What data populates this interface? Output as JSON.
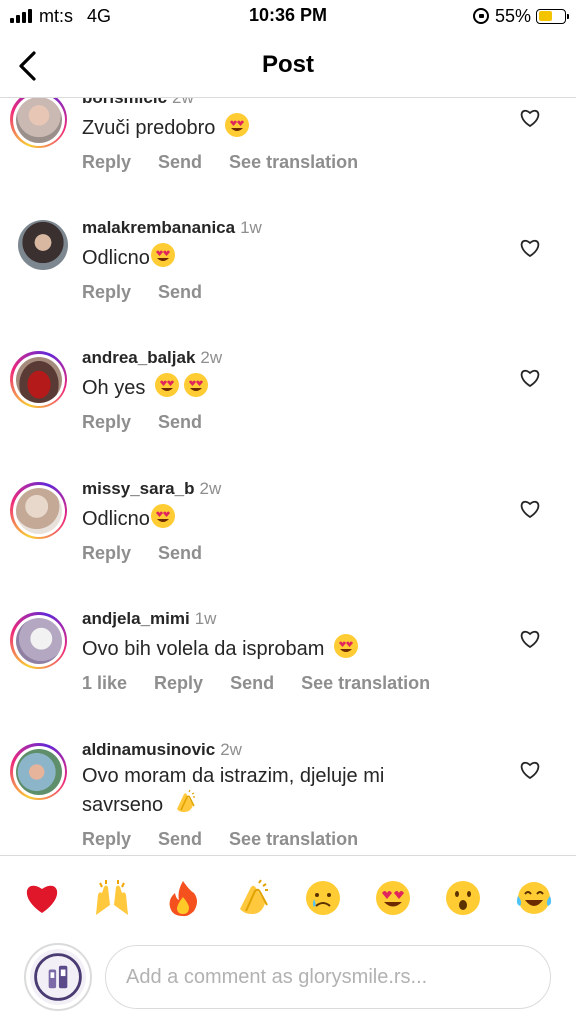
{
  "status_bar": {
    "carrier": "mt:s",
    "network": "4G",
    "time": "10:36 PM",
    "battery": "55%",
    "battery_level": 0.55,
    "battery_color": "#f5c400"
  },
  "header": {
    "back_icon": "chevron-left-icon",
    "title": "Post"
  },
  "comments": [
    {
      "username": "borismicic",
      "time": "2w",
      "text": "Zvuči predobro",
      "emojis": [
        "heart-eyes"
      ],
      "actions": [
        "Reply",
        "Send",
        "See translation"
      ],
      "avatar_ring": true
    },
    {
      "username": "malakrembananica",
      "time": "1w",
      "text": "Odlicno",
      "emojis": [
        "heart-eyes"
      ],
      "actions": [
        "Reply",
        "Send"
      ],
      "avatar_ring": false
    },
    {
      "username": "andrea_baljak",
      "time": "2w",
      "text": "Oh yes",
      "emojis": [
        "heart-eyes",
        "heart-eyes"
      ],
      "actions": [
        "Reply",
        "Send"
      ],
      "avatar_ring": true
    },
    {
      "username": "missy_sara_b",
      "time": "2w",
      "text": "Odlicno",
      "emojis": [
        "heart-eyes"
      ],
      "actions": [
        "Reply",
        "Send"
      ],
      "avatar_ring": true
    },
    {
      "username": "andjela_mimi",
      "time": "1w",
      "text": "Ovo bih volela da isprobam",
      "emojis": [
        "heart-eyes"
      ],
      "actions": [
        "1 like",
        "Reply",
        "Send",
        "See translation"
      ],
      "avatar_ring": true
    },
    {
      "username": "aldinamusinovic",
      "time": "2w",
      "text_lines": [
        "Ovo moram da istrazim, djeluje mi",
        "savrseno"
      ],
      "emojis": [
        "clapping-hands"
      ],
      "actions": [
        "Reply",
        "Send",
        "See translation"
      ],
      "avatar_ring": true
    }
  ],
  "emoji_bar": [
    "red-heart",
    "raising-hands",
    "fire",
    "clapping-hands",
    "crying-face",
    "heart-eyes",
    "surprised-face",
    "tears-of-joy"
  ],
  "composer": {
    "placeholder": "Add a comment as glorysmile.rs..."
  }
}
